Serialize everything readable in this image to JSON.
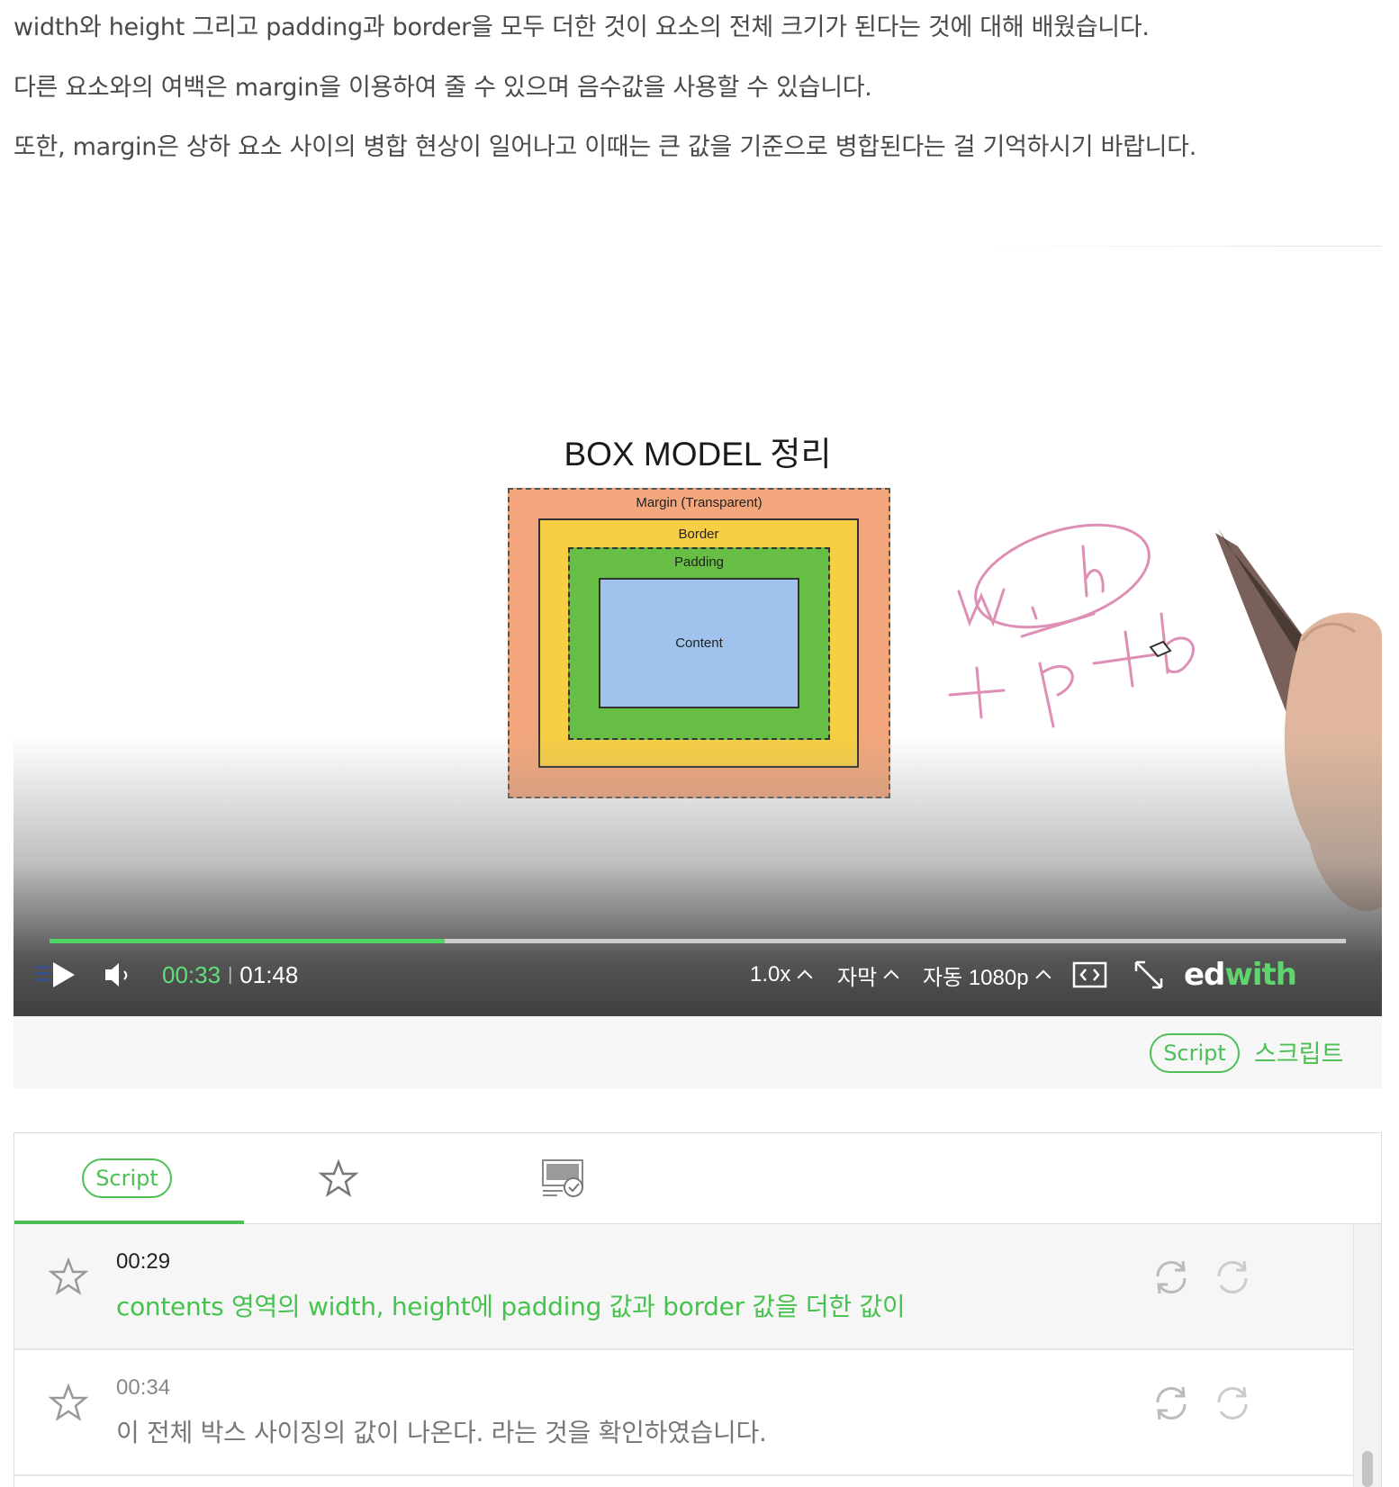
{
  "intro": {
    "line1": "width와 height 그리고 padding과 border을 모두 더한 것이 요소의 전체 크기가 된다는 것에 대해 배웠습니다.",
    "line2": "다른 요소와의 여백은 margin을 이용하여 줄 수 있으며 음수값을 사용할 수 있습니다.",
    "line3": "또한, margin은 상하 요소 사이의 병합 현상이 일어나고 이때는 큰 값을 기준으로 병합된다는 걸 기억하시기 바랍니다."
  },
  "video": {
    "slide_title": "BOX MODEL 정리",
    "box_model": {
      "margin": "Margin (Transparent)",
      "border": "Border",
      "padding": "Padding",
      "content": "Content"
    },
    "progress_fraction": 0.305,
    "time_current": "00:33",
    "time_separator": "|",
    "time_total": "01:48",
    "speed": "1.0x",
    "subtitle": "자막",
    "quality": "자동 1080p",
    "brand_ed": "ed",
    "brand_with": "with"
  },
  "script_bar": {
    "pill": "Script",
    "label": "스크립트"
  },
  "panel": {
    "tab_script": "Script",
    "rows": [
      {
        "time": "00:29",
        "text": "contents 영역의 width, height에 padding 값과 border 값을 더한 값이"
      },
      {
        "time": "00:34",
        "text": "이 전체 박스 사이징의 값이 나온다. 라는 것을 확인하였습니다."
      }
    ]
  },
  "colors": {
    "accent_green": "#4cbf55",
    "progress_green": "#4fd466"
  },
  "icons": [
    "playlist-icon",
    "play-icon",
    "volume-icon",
    "embed-icon",
    "fullscreen-icon",
    "star-icon",
    "note-icon",
    "repeat-icon"
  ]
}
